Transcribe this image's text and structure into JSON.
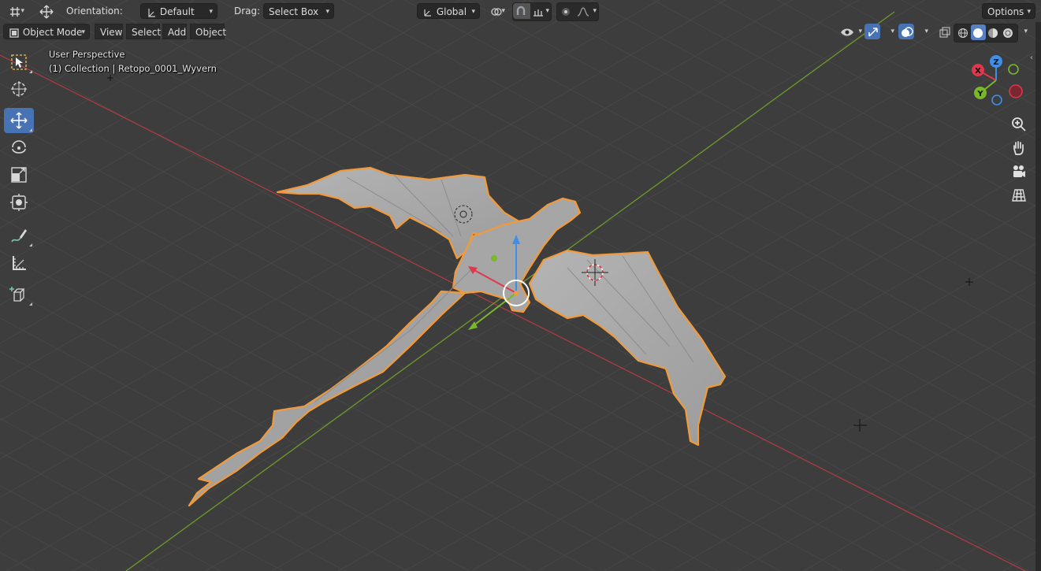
{
  "app": "Blender 3D Viewport",
  "header": {
    "orientation_label": "Orientation:",
    "orientation_value": "Default",
    "drag_label": "Drag:",
    "drag_value": "Select Box",
    "transform_orientation": "Global",
    "options_label": "Options"
  },
  "menu": {
    "mode": "Object Mode",
    "items": [
      "View",
      "Select",
      "Add",
      "Object"
    ]
  },
  "viewport": {
    "view_name": "User Perspective",
    "collection_info": "(1) Collection | Retopo_0001_Wyvern"
  },
  "gizmo": {
    "x_label": "X",
    "y_label": "Y",
    "z_label": "Z",
    "x_color": "#e0374d",
    "y_color": "#78b82a",
    "z_color": "#3f8ee8"
  },
  "colors": {
    "background": "#3d3d3d",
    "grid": "#474747",
    "x_axis": "#b23b44",
    "y_axis": "#6f9a2a",
    "selection_outline": "#f19a3c",
    "active_tool": "#4772b3",
    "mesh": "#a9a9a9"
  },
  "toolbar": {
    "tools": [
      "select-box-icon",
      "cursor-icon",
      "move-icon",
      "rotate-icon",
      "scale-icon",
      "transform-icon",
      "annotate-icon",
      "measure-icon",
      "add-cube-icon"
    ],
    "active": "move-icon"
  }
}
